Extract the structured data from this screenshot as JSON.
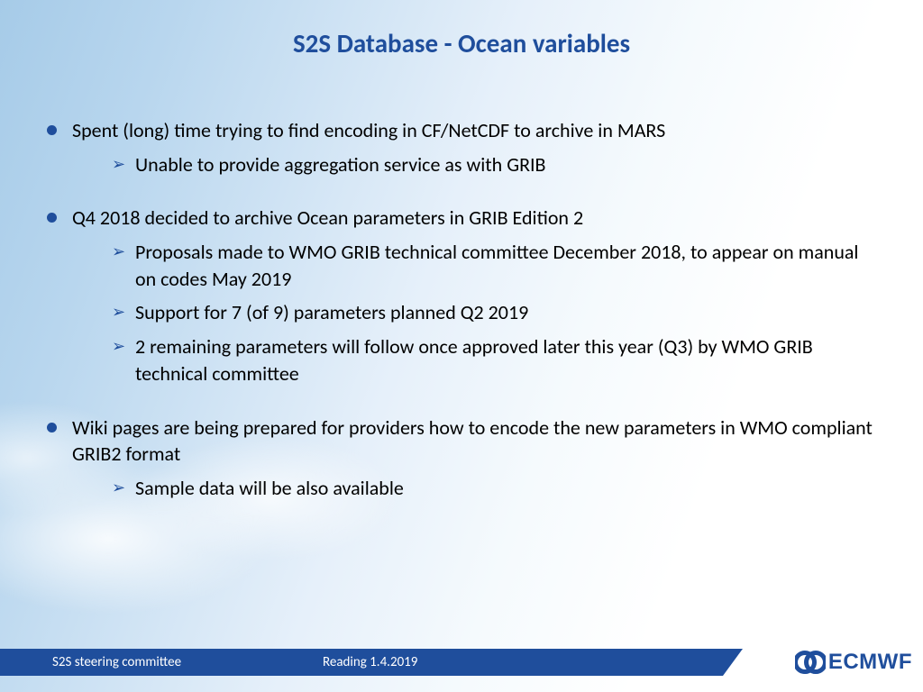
{
  "title": "S2S Database - Ocean variables",
  "bullets": [
    {
      "text": "Spent (long) time trying to find encoding in CF/NetCDF to archive in MARS",
      "sub": [
        "Unable to provide aggregation service as with GRIB"
      ]
    },
    {
      "text": "Q4 2018 decided to archive Ocean parameters in GRIB Edition 2",
      "sub": [
        "Proposals made to WMO GRIB technical committee December 2018, to appear on manual on codes May 2019",
        "Support for 7 (of 9) parameters planned Q2 2019",
        "2 remaining parameters will follow once approved later this year (Q3) by WMO GRIB technical committee"
      ]
    },
    {
      "text": "Wiki pages are being prepared for providers how to encode the new parameters in WMO compliant GRIB2 format",
      "sub": [
        "Sample data will be also available"
      ]
    }
  ],
  "footer": {
    "left": "S2S steering committee",
    "center": "Reading  1.4.2019",
    "logo_text": "ECMWF"
  },
  "colors": {
    "accent": "#1f4e9c"
  }
}
